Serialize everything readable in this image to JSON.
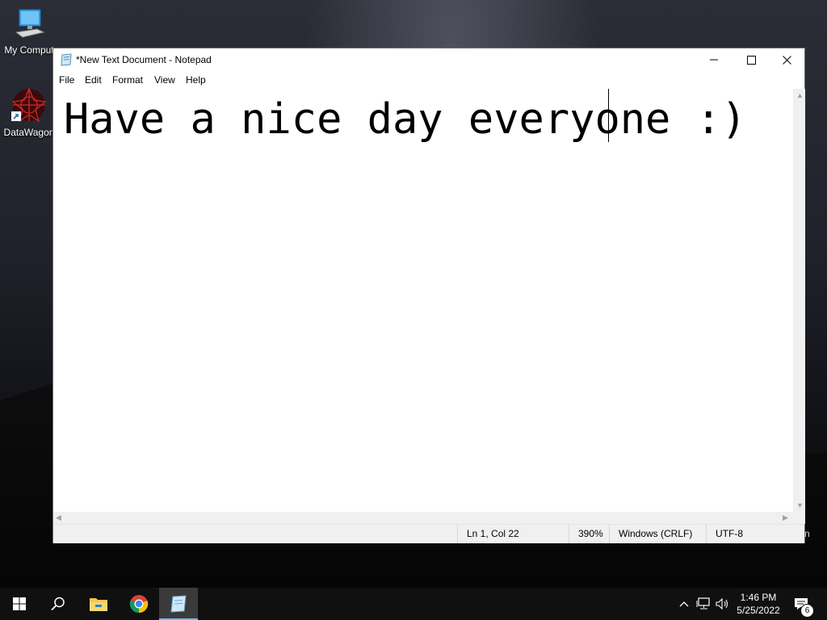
{
  "desktop": {
    "icons": [
      {
        "label": "My Computer",
        "display": "My Comput"
      },
      {
        "label": "DataWagon"
      }
    ],
    "stray_text": "n"
  },
  "window": {
    "title": "*New Text Document - Notepad",
    "menu": [
      "File",
      "Edit",
      "Format",
      "View",
      "Help"
    ],
    "content": "Have a nice day everyone :)",
    "status": {
      "position": "Ln 1, Col 22",
      "zoom": "390%",
      "line_endings": "Windows (CRLF)",
      "encoding": "UTF-8"
    }
  },
  "taskbar": {
    "items": [
      "start-icon",
      "search-icon",
      "file-explorer-icon",
      "chrome-icon",
      "notepad-icon"
    ],
    "clock": {
      "time": "1:46 PM",
      "date": "5/25/2022"
    },
    "notifications_count": "6"
  }
}
